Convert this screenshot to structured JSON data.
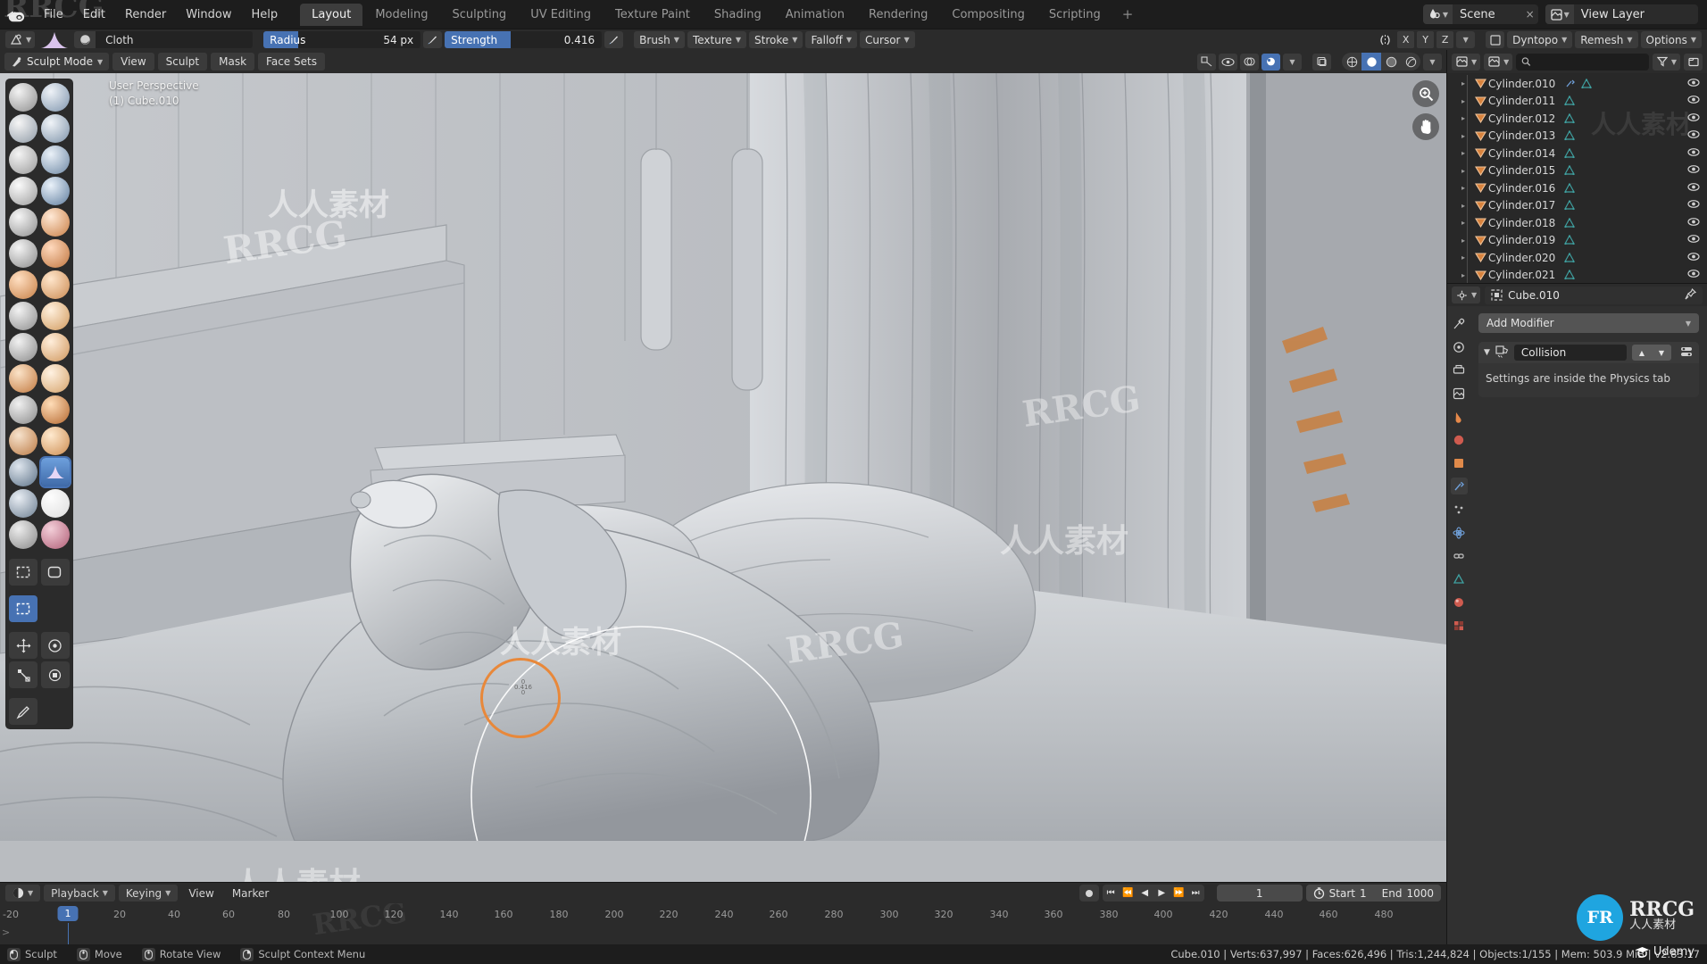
{
  "topbar": {
    "logo_icon": "blender-logo-icon",
    "menus": [
      "File",
      "Edit",
      "Render",
      "Window",
      "Help"
    ],
    "workspace_tabs": [
      {
        "label": "Layout",
        "active": true
      },
      {
        "label": "Modeling",
        "active": false
      },
      {
        "label": "Sculpting",
        "active": false
      },
      {
        "label": "UV Editing",
        "active": false
      },
      {
        "label": "Texture Paint",
        "active": false
      },
      {
        "label": "Shading",
        "active": false
      },
      {
        "label": "Animation",
        "active": false
      },
      {
        "label": "Rendering",
        "active": false
      },
      {
        "label": "Compositing",
        "active": false
      },
      {
        "label": "Scripting",
        "active": false
      }
    ],
    "add_workspace_label": "+",
    "scene_name": "Scene",
    "scene_close_label": "×",
    "view_layer_name": "View Layer"
  },
  "toolrow": {
    "brush_name": "Cloth",
    "radius_label": "Radius",
    "radius_value": "54 px",
    "radius_fill_pct": 22,
    "strength_label": "Strength",
    "strength_value": "0.416",
    "strength_fill_pct": 42,
    "menus": [
      "Brush",
      "Texture",
      "Stroke",
      "Falloff",
      "Cursor"
    ],
    "symmetry_axes": [
      "X",
      "Y",
      "Z"
    ],
    "dyntopo_label": "Dyntopo",
    "remesh_label": "Remesh",
    "options_label": "Options"
  },
  "viewport": {
    "mode_label": "Sculpt Mode",
    "menus": [
      "View",
      "Sculpt",
      "Mask",
      "Face Sets"
    ],
    "overlay_perspective": "User Perspective",
    "overlay_object": "(1) Cube.010",
    "brush_tools": [
      "draw-brush",
      "draw-sharp-brush",
      "clay-brush",
      "clay-strips-brush",
      "clay-thumb-brush",
      "layer-brush",
      "inflate-brush",
      "blob-brush",
      "crease-brush",
      "smooth-brush",
      "flatten-brush",
      "fill-brush",
      "scrape-brush",
      "multiplane-scrape-brush",
      "pinch-brush",
      "grab-brush",
      "elastic-deform-brush",
      "snake-hook-brush",
      "thumb-brush",
      "pose-brush",
      "nudge-brush",
      "rotate-brush",
      "slide-relax-brush",
      "boundary-brush",
      "cloth-brush",
      "simplify-brush",
      "mask-brush",
      "draw-face-sets-brush",
      "multires-displacement-eraser-brush",
      "paint-brush"
    ],
    "selected_brush": "cloth-brush",
    "utility_tools": [
      "box-mask-tool",
      "lasso-mask-tool",
      "box-hide-tool",
      "move-tool",
      "rotate-tool",
      "scale-tool",
      "transform-tool",
      "annotate-tool"
    ],
    "gizmo_icons": [
      "zoom-gizmo-icon",
      "pan-hand-gizmo-icon"
    ],
    "shading_modes": [
      "wireframe-shading",
      "solid-shading",
      "material-preview-shading",
      "rendered-shading"
    ],
    "active_shading": "solid-shading"
  },
  "timeline": {
    "editor_icon": "timeline-editor-icon",
    "menus": [
      "Playback",
      "Keying",
      "View",
      "Marker"
    ],
    "transport_buttons": [
      "jump-to-start",
      "previous-keyframe",
      "play-reverse",
      "play",
      "next-keyframe",
      "jump-to-end"
    ],
    "record_button": "auto-keying-toggle",
    "current_frame": "1",
    "start_label": "Start",
    "start_value": "1",
    "end_label": "End",
    "end_value": "1000",
    "tick_labels": [
      "-20",
      "20",
      "40",
      "60",
      "80",
      "100",
      "120",
      "140",
      "160",
      "180",
      "200",
      "220",
      "240",
      "260",
      "280",
      "300",
      "320",
      "340",
      "360",
      "380",
      "400",
      "420",
      "440",
      "460",
      "480"
    ],
    "playhead_frame": "1"
  },
  "outliner": {
    "display_mode_icon": "view-layer-icon",
    "search_placeholder": "",
    "filter_icon": "filter-icon",
    "rows": [
      {
        "name": "Cylinder.010",
        "has_modifier": true
      },
      {
        "name": "Cylinder.011",
        "has_modifier": false
      },
      {
        "name": "Cylinder.012",
        "has_modifier": false
      },
      {
        "name": "Cylinder.013",
        "has_modifier": false
      },
      {
        "name": "Cylinder.014",
        "has_modifier": false
      },
      {
        "name": "Cylinder.015",
        "has_modifier": false
      },
      {
        "name": "Cylinder.016",
        "has_modifier": false
      },
      {
        "name": "Cylinder.017",
        "has_modifier": false
      },
      {
        "name": "Cylinder.018",
        "has_modifier": false
      },
      {
        "name": "Cylinder.019",
        "has_modifier": false
      },
      {
        "name": "Cylinder.020",
        "has_modifier": false
      },
      {
        "name": "Cylinder.021",
        "has_modifier": false
      }
    ]
  },
  "properties": {
    "editor_icon": "properties-editor-icon",
    "breadcrumb_object": "Cube.010",
    "pin_icon": "pin-icon",
    "add_modifier_label": "Add Modifier",
    "modifier": {
      "name": "Collision",
      "icon": "physics-collision-icon",
      "body_text": "Settings are inside the Physics tab",
      "move_up_label": "▲",
      "move_down_label": "▼"
    },
    "tabs": [
      "tool-tab",
      "render-tab",
      "output-tab",
      "view-layer-tab",
      "scene-tab",
      "world-tab",
      "object-tab",
      "modifier-tab",
      "particles-tab",
      "physics-tab",
      "constraints-tab",
      "data-tab",
      "material-tab",
      "texture-tab"
    ],
    "active_tab": "modifier-tab"
  },
  "statusbar": {
    "items": [
      {
        "key_icon": "mouse-left-icon",
        "label": "Sculpt"
      },
      {
        "key_icon": "mouse-middle-icon",
        "label": "Move"
      },
      {
        "key_icon": "mouse-middle-icon",
        "label": "Rotate View"
      },
      {
        "key_icon": "mouse-right-icon",
        "label": "Sculpt Context Menu"
      }
    ],
    "stats": "Cube.010 | Verts:637,997 | Faces:626,496 | Tris:1,244,824 | Objects:1/155 | Mem: 503.9 MiB | v2.83.17"
  },
  "watermarks": {
    "corner_logo": "RRCG",
    "badge_initials": "FR",
    "badge_title": "RRCG",
    "badge_sub": "人人素材",
    "udemy": "Udemy",
    "tile_text": "人人素材",
    "tile_text2": "RRCG"
  },
  "colors": {
    "accent": "#4772b3",
    "brush_cursor": "#e8883a",
    "header_bg": "#2b2b2b",
    "panel_bg": "#303030",
    "outliner_bg": "#282828",
    "topbar_bg": "#1d1d1d",
    "mesh_icon": "#2a8f8f",
    "object_icon": "#e08a4a"
  }
}
